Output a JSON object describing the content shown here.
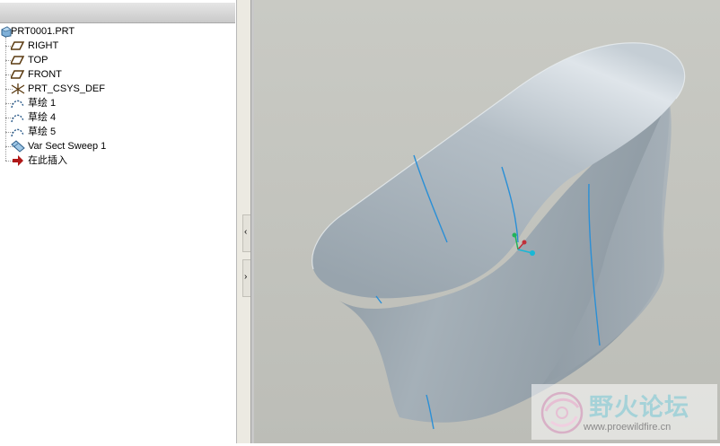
{
  "model_tree": {
    "root": {
      "label": "PRT0001.PRT",
      "icon": "part-icon"
    },
    "items": [
      {
        "label": "RIGHT",
        "icon": "datum-plane-icon"
      },
      {
        "label": "TOP",
        "icon": "datum-plane-icon"
      },
      {
        "label": "FRONT",
        "icon": "datum-plane-icon"
      },
      {
        "label": "PRT_CSYS_DEF",
        "icon": "coordinate-system-icon"
      },
      {
        "label": "草绘 1",
        "icon": "sketch-icon"
      },
      {
        "label": "草绘 4",
        "icon": "sketch-icon"
      },
      {
        "label": "草绘 5",
        "icon": "sketch-icon"
      },
      {
        "label": "Var Sect Sweep 1",
        "icon": "sweep-surface-icon"
      },
      {
        "label": "在此插入",
        "icon": "insert-here-arrow-icon"
      }
    ]
  },
  "scrollbar": {
    "collapse_glyph": "‹",
    "expand_glyph": "›"
  },
  "watermark": {
    "title": "野火论坛",
    "url": "www.proewildfire.cn"
  },
  "colors": {
    "surface": "#a9b4bc",
    "background": "#c4c5bf",
    "curve": "#2a8fd6"
  }
}
